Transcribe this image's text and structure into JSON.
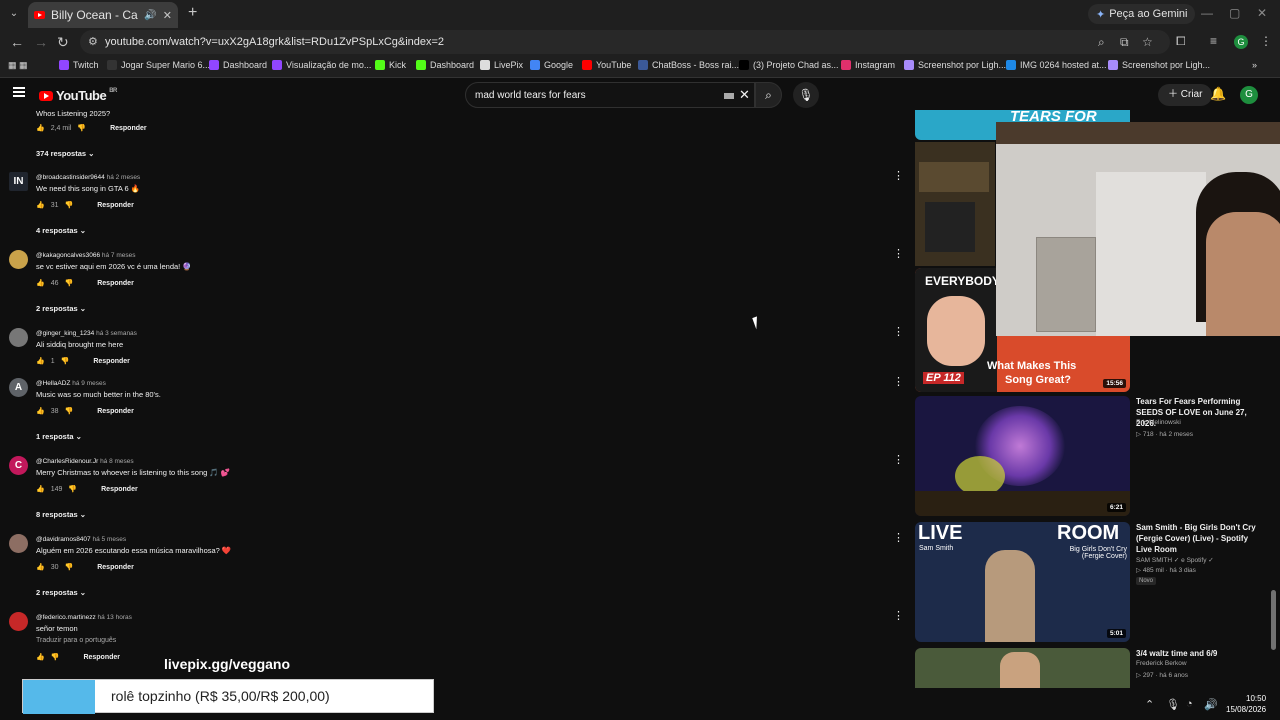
{
  "browser": {
    "tab_title": "Billy Ocean - Caribbean Qu",
    "gemini_label": "Peça ao Gemini",
    "url": "youtube.com/watch?v=uxX2gA18grk&list=RDu1ZvPSpLxCg&index=2",
    "avatar_letter": "G",
    "bookmarks": [
      "Twitch",
      "Jogar Super Mario 6...",
      "Dashboard",
      "Visualização de mo...",
      "Kick",
      "Dashboard",
      "LivePix",
      "Google",
      "YouTube",
      "ChatBoss - Boss rai...",
      "(3) Projeto Chad as...",
      "Instagram",
      "Screenshot por Ligh...",
      "IMG 0264 hosted at...",
      "Screenshot por Ligh..."
    ]
  },
  "youtube": {
    "logo": "YouTube",
    "logo_suffix": "BR",
    "search_value": "mad world tears for fears",
    "create_label": "Criar",
    "avatar_letter": "G"
  },
  "comments": {
    "top_partial": {
      "text": "Whos Listening 2025?",
      "likes": "2,4 mil",
      "reply": "Responder",
      "replies": "374 respostas"
    },
    "items": [
      {
        "author": "@broadcastinsider9644",
        "ago": "há 2 meses",
        "text": "We need this song in GTA 6 🔥",
        "likes": "31",
        "reply": "Responder",
        "replies": "4 respostas",
        "avatar": "IN"
      },
      {
        "author": "@kakagoncalves3066",
        "ago": "há 7 meses",
        "text": "se vc estiver aqui em 2026 vc é uma lenda! 🔮",
        "likes": "46",
        "reply": "Responder",
        "replies": "2 respostas",
        "avatar": ""
      },
      {
        "author": "@ginger_king_1234",
        "ago": "há 3 semanas",
        "text": "Ali siddiq brought me here",
        "likes": "1",
        "reply": "Responder",
        "replies": "",
        "avatar": ""
      },
      {
        "author": "@HellaADZ",
        "ago": "há 9 meses",
        "text": "Music was so much better in the 80's.",
        "likes": "38",
        "reply": "Responder",
        "replies": "1 resposta",
        "avatar": "A"
      },
      {
        "author": "@CharlesRidenour.Jr",
        "ago": "há 8 meses",
        "text": "Merry Christmas to whoever is listening to this song 🎵 💕",
        "likes": "149",
        "reply": "Responder",
        "replies": "8 respostas",
        "avatar": "C"
      },
      {
        "author": "@davidramos8407",
        "ago": "há 5 meses",
        "text": "Alguém em 2026 escutando essa música maravilhosa? ❤️",
        "likes": "30",
        "reply": "Responder",
        "replies": "2 respostas",
        "avatar": ""
      },
      {
        "author": "@federico.martinezz",
        "ago": "há 13 horas",
        "text": "señor temon",
        "likes": "",
        "reply": "Responder",
        "replies": "",
        "avatar": "",
        "translate": "Traduzir para o português"
      }
    ]
  },
  "sidebar": {
    "thumb_top_text": "TEARS FOR FEARS!",
    "thumb_ep": {
      "line1": "EVERYBODY W",
      "line2": "What Makes This",
      "line3": "Song Great?",
      "tag": "EP 112",
      "duration": "15:56"
    },
    "videos": [
      {
        "title": "Tears For Fears Performing SEEDS OF LOVE on June 27, 2026.",
        "channel": "Eric Melinowski",
        "meta": "718 · há 2 meses",
        "duration": "6:21"
      },
      {
        "title": "Sam Smith - Big Girls Don't Cry (Fergie Cover) (Live) - Spotify Live Room",
        "channel": "SAM SMITH ✓ e Spotify ✓",
        "meta": "485 mil · há 3 dias",
        "badge": "Novo",
        "duration": "5:01",
        "thumb_left": "LIVE",
        "thumb_right": "ROOM",
        "thumb_name": "Sam Smith",
        "thumb_sub": "Big Girls Don't Cry (Fergie Cover)"
      },
      {
        "title": "3/4 waltz time and 6/9",
        "channel": "Frederick Berkow",
        "meta": "297 · há 6 anos"
      }
    ]
  },
  "overlay": {
    "livepix": "livepix.gg/veggano",
    "donation": "rolê topzinho (R$ 35,00/R$ 200,00)",
    "donation_progress": 0.175
  },
  "clock": {
    "time": "10:50",
    "date": "15/08/2026"
  }
}
